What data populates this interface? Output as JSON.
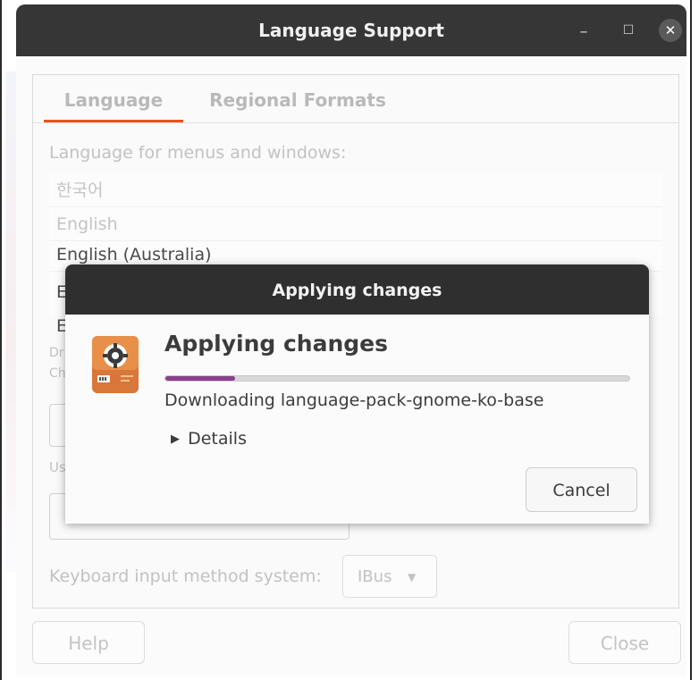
{
  "window": {
    "title": "Language Support",
    "close_glyph": "✕",
    "minimize_glyph": "–",
    "maximize_glyph": "☐"
  },
  "tabs": [
    {
      "label": "Language",
      "active": true
    },
    {
      "label": "Regional Formats",
      "active": false
    }
  ],
  "language_section": {
    "label": "Language for menus and windows:",
    "items": [
      "한국어",
      "English",
      "English (Australia)",
      "E",
      "E"
    ]
  },
  "background_fragments": {
    "drawing_label_a": "Dr",
    "drawing_label_b": "Ch",
    "use_label": "Us"
  },
  "keyboard": {
    "label": "Keyboard input method system:",
    "selected": "IBus"
  },
  "footer": {
    "help_label": "Help",
    "close_label": "Close"
  },
  "dialog": {
    "title": "Applying changes",
    "heading": "Applying changes",
    "progress": 0.15,
    "status": "Downloading language-pack-gnome-ko-base",
    "details_label": "Details",
    "cancel_label": "Cancel"
  },
  "colors": {
    "accent": "#e95420",
    "progress": "#8a3f8f",
    "titlebar": "#363636"
  },
  "icons": {
    "app": "package-gear-icon",
    "details": "triangle-right-icon",
    "dropdown": "triangle-down-icon"
  }
}
